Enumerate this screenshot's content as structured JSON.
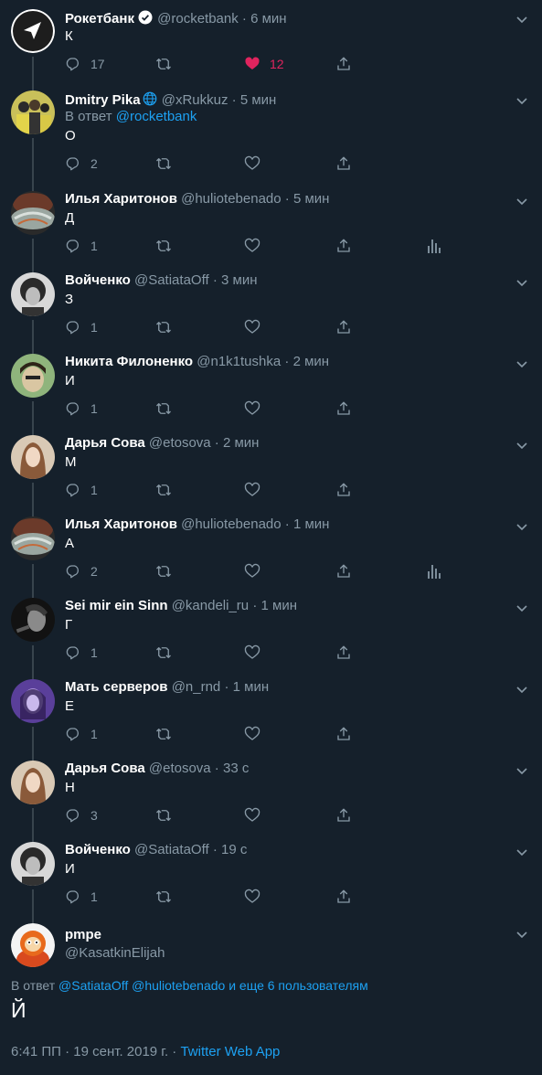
{
  "tweets": [
    {
      "name": "Рокетбанк",
      "handle": "@rocketbank",
      "time": "6 мин",
      "verified": true,
      "reply_prefix": "",
      "reply_link": "",
      "text": "К",
      "replies": "17",
      "likes": "12",
      "liked": true,
      "analytics": false,
      "avatar": "logo"
    },
    {
      "name": "Dmitry Pika",
      "handle": "@xRukkuz",
      "time": "5 мин",
      "globe": true,
      "reply_prefix": "В ответ ",
      "reply_link": "@rocketbank",
      "text": "О",
      "replies": "2",
      "likes": "",
      "analytics": false,
      "avatar": "group"
    },
    {
      "name": "Илья Харитонов",
      "handle": "@huliotebenado",
      "time": "5 мин",
      "reply_prefix": "",
      "reply_link": "",
      "text": "Д",
      "replies": "1",
      "likes": "",
      "analytics": true,
      "avatar": "craft"
    },
    {
      "name": "Войченко",
      "handle": "@SatiataOff",
      "time": "3 мин",
      "reply_prefix": "",
      "reply_link": "",
      "text": "З",
      "replies": "1",
      "likes": "",
      "analytics": false,
      "avatar": "curly"
    },
    {
      "name": "Никита Филоненко",
      "handle": "@n1k1tushka",
      "time": "2 мин",
      "reply_prefix": "",
      "reply_link": "",
      "text": "И",
      "replies": "1",
      "likes": "",
      "analytics": false,
      "avatar": "green"
    },
    {
      "name": "Дарья Сова",
      "handle": "@etosova",
      "time": "2 мин",
      "reply_prefix": "",
      "reply_link": "",
      "text": "М",
      "replies": "1",
      "likes": "",
      "analytics": false,
      "avatar": "girl"
    },
    {
      "name": "Илья Харитонов",
      "handle": "@huliotebenado",
      "time": "1 мин",
      "reply_prefix": "",
      "reply_link": "",
      "text": "А",
      "replies": "2",
      "likes": "",
      "analytics": true,
      "avatar": "craft"
    },
    {
      "name": "Sei mir ein Sinn",
      "handle": "@kandeli_ru",
      "time": "1 мин",
      "reply_prefix": "",
      "reply_link": "",
      "text": "Г",
      "replies": "1",
      "likes": "",
      "analytics": false,
      "avatar": "dark"
    },
    {
      "name": "Мать серверов",
      "handle": "@n_rnd",
      "time": "1 мин",
      "reply_prefix": "",
      "reply_link": "",
      "text": "Е",
      "replies": "1",
      "likes": "",
      "analytics": false,
      "avatar": "purple"
    },
    {
      "name": "Дарья Сова",
      "handle": "@etosova",
      "time": "33 с",
      "reply_prefix": "",
      "reply_link": "",
      "text": "Н",
      "replies": "3",
      "likes": "",
      "analytics": false,
      "avatar": "girl"
    },
    {
      "name": "Войченко",
      "handle": "@SatiataOff",
      "time": "19 с",
      "reply_prefix": "",
      "reply_link": "",
      "text": "И",
      "replies": "1",
      "likes": "",
      "analytics": false,
      "avatar": "curly"
    }
  ],
  "main": {
    "name": "pmpe",
    "handle": "@KasatkinElijah",
    "reply_prefix": "В ответ ",
    "reply_links": "@SatiataOff @huliotebenado и еще 6 пользователям",
    "text": "Й",
    "timestamp": "6:41 ПП · 19 сент. 2019 г. · ",
    "source": "Twitter Web App"
  },
  "colors": {
    "background": "#15202b",
    "muted": "#8899a6",
    "link": "#1da1f2",
    "like": "#e0245e",
    "thread_line": "#38444d"
  }
}
